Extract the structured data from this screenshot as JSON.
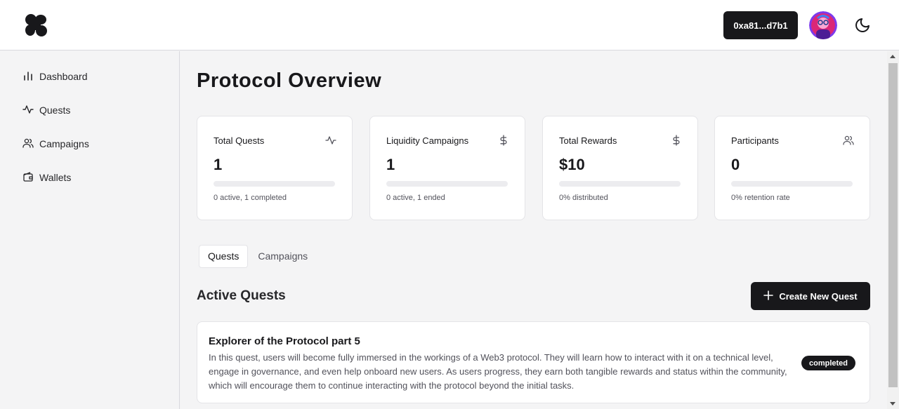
{
  "header": {
    "wallet_address": "0xa81...d7b1",
    "logo_icon": "clover-logo-icon",
    "theme_icon": "moon-icon"
  },
  "sidebar": {
    "items": [
      {
        "label": "Dashboard",
        "icon": "bar-chart-icon"
      },
      {
        "label": "Quests",
        "icon": "activity-icon"
      },
      {
        "label": "Campaigns",
        "icon": "users-icon"
      },
      {
        "label": "Wallets",
        "icon": "wallet-icon"
      }
    ]
  },
  "main": {
    "title": "Protocol Overview",
    "stats": [
      {
        "title": "Total Quests",
        "value": "1",
        "sub": "0 active, 1 completed",
        "icon": "activity-icon",
        "progress": 0
      },
      {
        "title": "Liquidity Campaigns",
        "value": "1",
        "sub": "0 active, 1 ended",
        "icon": "dollar-icon",
        "progress": 0
      },
      {
        "title": "Total Rewards",
        "value": "$10",
        "sub": "0% distributed",
        "icon": "dollar-icon",
        "progress": 0
      },
      {
        "title": "Participants",
        "value": "0",
        "sub": "0% retention rate",
        "icon": "users-icon",
        "progress": 0
      }
    ],
    "tabs": [
      {
        "label": "Quests",
        "active": true
      },
      {
        "label": "Campaigns",
        "active": false
      }
    ],
    "section_title": "Active Quests",
    "create_button": "Create New Quest",
    "quests": [
      {
        "title": "Explorer of the Protocol part 5",
        "description": "In this quest, users will become fully immersed in the workings of a Web3 protocol. They will learn how to interact with it on a technical level, engage in governance, and even help onboard new users. As users progress, they earn both tangible rewards and status within the community, which will encourage them to continue interacting with the protocol beyond the initial tasks.",
        "status": "completed"
      }
    ]
  },
  "colors": {
    "primary": "#18181b",
    "background": "#f4f4f5",
    "card": "#ffffff",
    "muted_text": "#52525b"
  }
}
